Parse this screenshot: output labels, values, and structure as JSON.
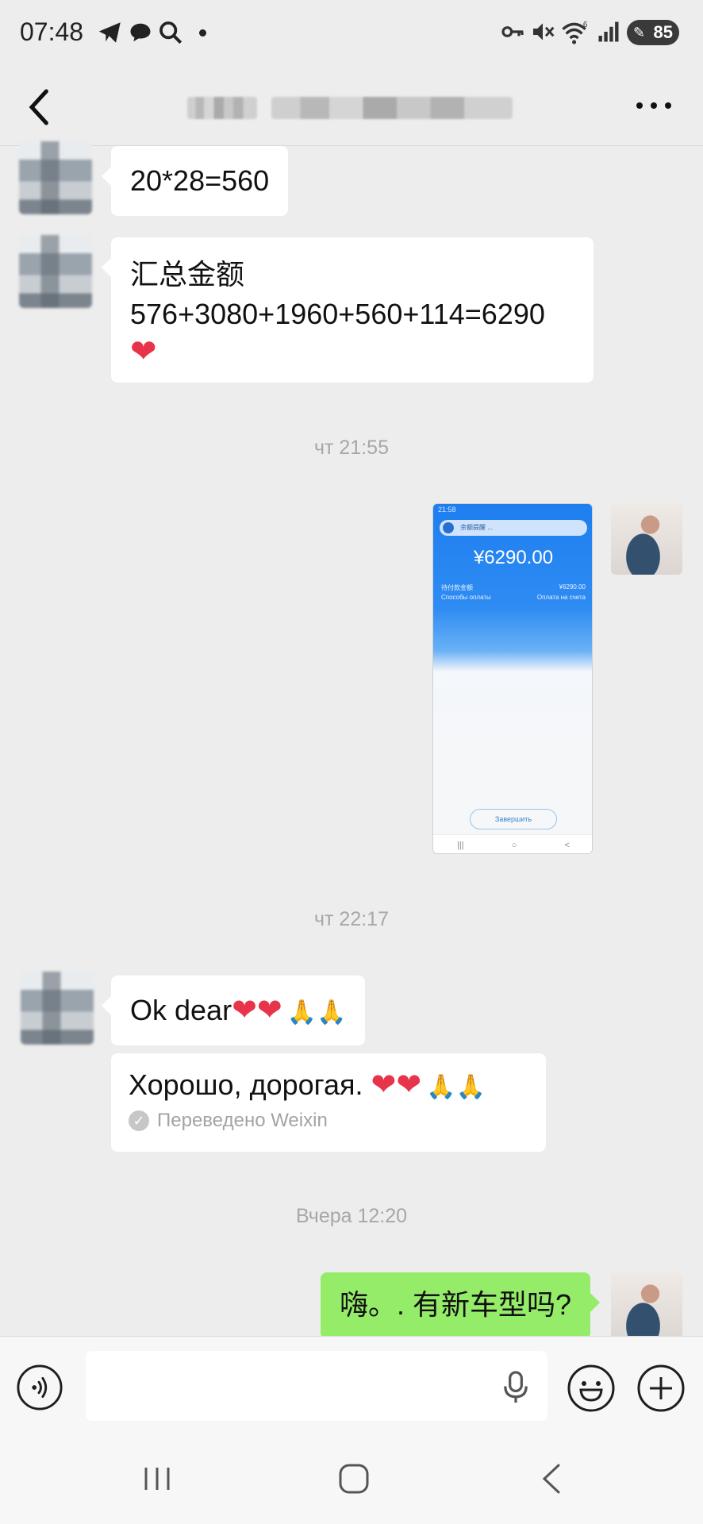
{
  "status_bar": {
    "time": "07:48",
    "battery": "85",
    "icons": [
      "telegram-icon",
      "chat-icon",
      "search-icon",
      "dot-icon",
      "key-icon",
      "mute-icon",
      "wifi-icon",
      "signal-icon",
      "battery-icon"
    ]
  },
  "header": {
    "title": "",
    "back_icon": "chevron-left-icon",
    "more_icon": "more-dots-icon"
  },
  "messages": [
    {
      "type": "incoming",
      "text": "20*28=560"
    },
    {
      "type": "incoming",
      "line1": "汇总金额",
      "line2": "576+3080+1960+560+114=6290",
      "emoji": "❤"
    },
    {
      "type": "timestamp",
      "text": "чт 21:55"
    },
    {
      "type": "outgoing-image",
      "screenshot": {
        "status": "21:58",
        "banner": "余额提醒 ...",
        "amount": "¥6290.00",
        "row1_left": "待付款金额",
        "row1_right": "¥6290.00",
        "row2_left": "Способы оплаты",
        "row2_right": "Оплата на счета",
        "button": "Завершить",
        "nav": [
          "|||",
          "○",
          "<"
        ]
      }
    },
    {
      "type": "timestamp",
      "text": "чт 22:17"
    },
    {
      "type": "incoming",
      "text": "Ok dear",
      "hearts": "❤❤",
      "pray": "🙏🙏"
    },
    {
      "type": "translation",
      "text": "Хорошо, дорогая. ",
      "hearts": "❤❤",
      "pray": "🙏🙏",
      "meta": "Переведено Weixin"
    },
    {
      "type": "timestamp",
      "text": "Вчера 12:20"
    },
    {
      "type": "outgoing",
      "text": "嗨。. 有新车型吗?"
    }
  ],
  "input_bar": {
    "voice_icon": "voice-icon",
    "placeholder": "",
    "mic_icon": "microphone-icon",
    "emoji_icon": "smiley-icon",
    "plus_icon": "plus-icon"
  },
  "nav_bar": {
    "icons": [
      "recent-apps-icon",
      "home-icon",
      "back-icon"
    ]
  }
}
